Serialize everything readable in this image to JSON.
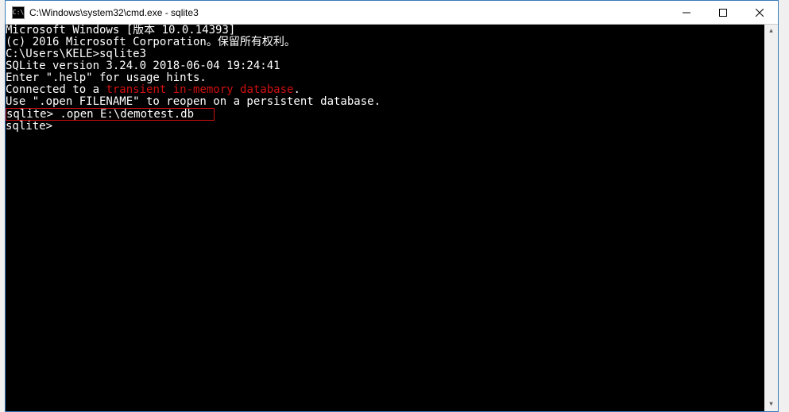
{
  "titlebar": {
    "icon_label": "C:\\",
    "title": "C:\\Windows\\system32\\cmd.exe - sqlite3",
    "minimize_glyph": "—",
    "maximize_glyph": "☐",
    "close_glyph": "✕"
  },
  "terminal": {
    "lines": {
      "l1": "Microsoft Windows [版本 10.0.14393]",
      "l2": "(c) 2016 Microsoft Corporation。保留所有权利。",
      "l3": "",
      "l4": "C:\\Users\\KELE>sqlite3",
      "l5": "SQLite version 3.24.0 2018-06-04 19:24:41",
      "l6": "Enter \".help\" for usage hints.",
      "l7a": "Connected to a ",
      "l7b": "transient in-memory database",
      "l7c": ".",
      "l8": "Use \".open FILENAME\" to reopen on a persistent database.",
      "l9": "sqlite> .open E:\\demotest.db   ",
      "l10": "sqlite>"
    }
  },
  "scrollbar": {
    "up": "▲",
    "down": "▼"
  }
}
